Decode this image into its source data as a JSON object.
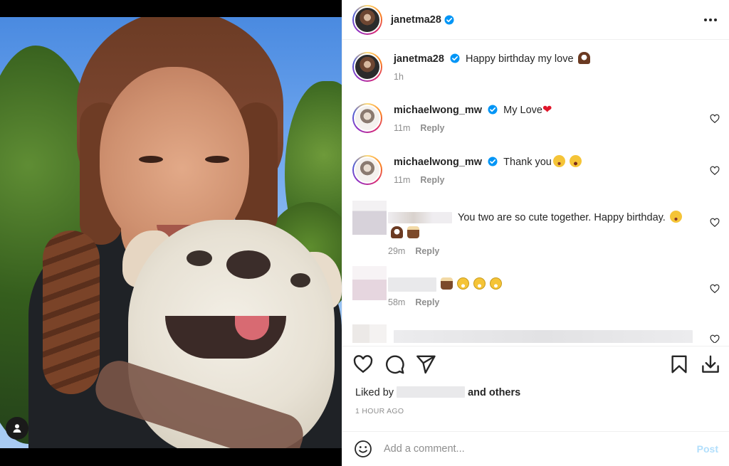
{
  "post": {
    "author": "janetma28",
    "more_icon": "more-horizontal-icon",
    "verified_color": "#0095f6"
  },
  "caption": {
    "username": "janetma28",
    "text": "Happy birthday my love",
    "time": "1h"
  },
  "comments": [
    {
      "username": "michaelwong_mw",
      "text": "My Love",
      "time": "11m",
      "reply": "Reply"
    },
    {
      "username": "michaelwong_mw",
      "text": "Thank you",
      "time": "11m",
      "reply": "Reply"
    },
    {
      "username": "",
      "text": "You two are so cute together. Happy birthday.",
      "time": "29m",
      "reply": "Reply"
    },
    {
      "username": "",
      "text": "",
      "time": "58m",
      "reply": "Reply"
    }
  ],
  "actions": {
    "like_icon": "heart-icon",
    "comment_icon": "comment-icon",
    "share_icon": "send-icon",
    "save_icon": "bookmark-icon",
    "download_icon": "download-icon"
  },
  "likes": {
    "prefix": "Liked by",
    "suffix": "and others"
  },
  "timestamp": "1 HOUR AGO",
  "composer": {
    "placeholder": "Add a comment...",
    "post_label": "Post",
    "emoji_icon": "smiley-icon",
    "post_color": "#b2dffc"
  },
  "colors": {
    "text": "#262626",
    "secondary": "#8e8e8e",
    "border": "#efefef",
    "heart_emoji": "#e0152a"
  }
}
